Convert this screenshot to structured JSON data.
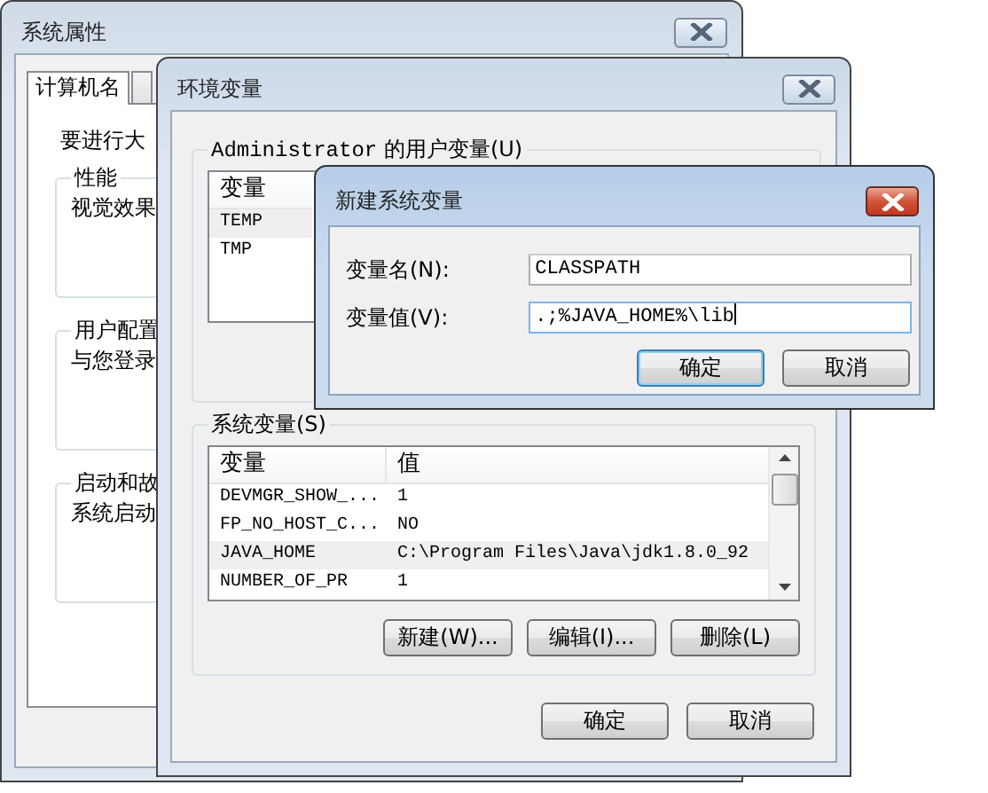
{
  "system_properties": {
    "title": "系统属性",
    "tabs": [
      {
        "label": "计算机名",
        "selected": true
      },
      {
        "selected": false
      }
    ],
    "intro": "要进行大",
    "groups": [
      {
        "label": "性能",
        "text": "视觉效果"
      },
      {
        "label": "用户配置",
        "text": "与您登录"
      },
      {
        "label": "启动和故",
        "text": "系统启动"
      }
    ]
  },
  "environment_variables": {
    "title": "环境变量",
    "user_variables": {
      "label": "Administrator 的用户变量(U)",
      "columns": [
        "变量"
      ],
      "rows": [
        {
          "name": "TEMP",
          "highlighted": true
        },
        {
          "name": "TMP",
          "highlighted": false
        }
      ]
    },
    "system_variables": {
      "label": "系统变量(S)",
      "columns": [
        "变量",
        "值"
      ],
      "rows": [
        {
          "name": "DEVMGR_SHOW_...",
          "value": "1",
          "highlighted": false
        },
        {
          "name": "FP_NO_HOST_C...",
          "value": "NO",
          "highlighted": false
        },
        {
          "name": "JAVA_HOME",
          "value": "C:\\Program Files\\Java\\jdk1.8.0_92",
          "highlighted": true
        },
        {
          "name": "NUMBER_OF_PR",
          "value": "1",
          "highlighted": false
        }
      ],
      "buttons": [
        "新建(W)...",
        "编辑(I)...",
        "删除(L)"
      ]
    },
    "buttons": [
      "确定",
      "取消"
    ]
  },
  "new_system_variable": {
    "title": "新建系统变量",
    "fields": [
      {
        "label": "变量名(N):",
        "value": "CLASSPATH",
        "focused": false
      },
      {
        "label": "变量值(V):",
        "value": ".;%JAVA_HOME%\\lib",
        "focused": true
      }
    ],
    "buttons": [
      {
        "label": "确定",
        "default": true
      },
      {
        "label": "取消",
        "default": false
      }
    ]
  }
}
